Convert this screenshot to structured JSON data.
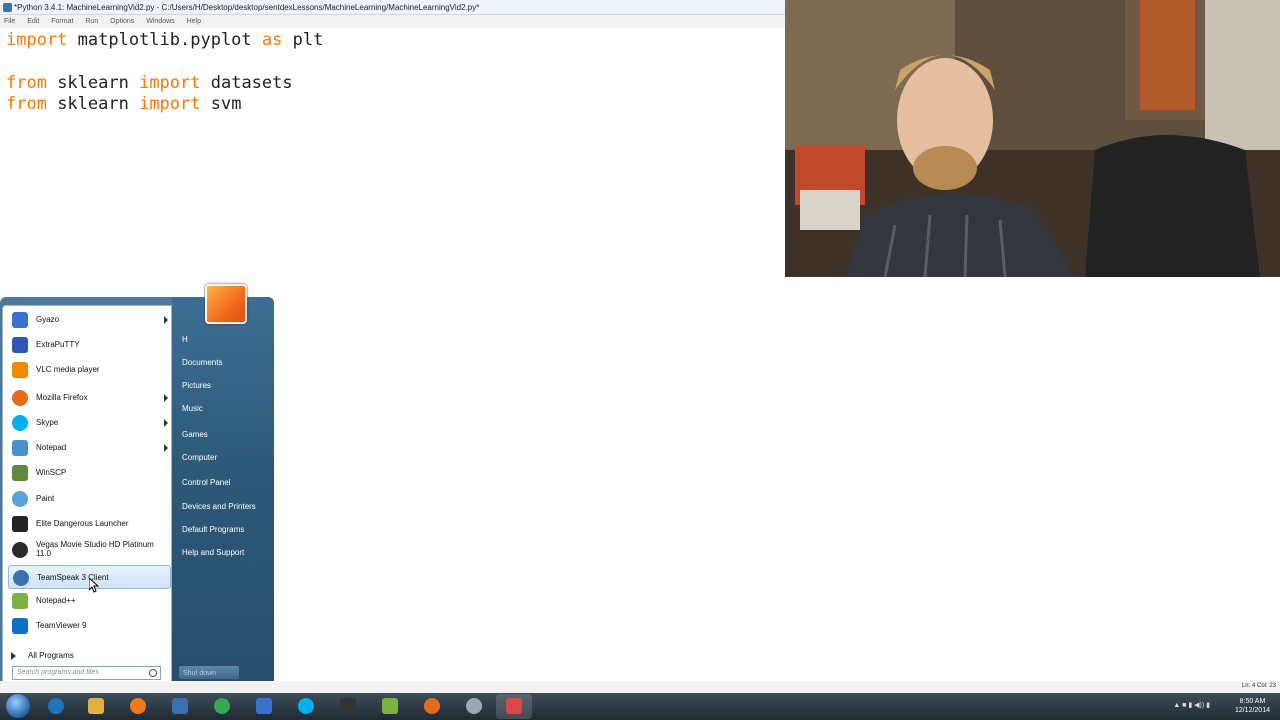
{
  "window": {
    "title": "*Python 3.4.1: MachineLearningVid2.py - C:/Users/H/Desktop/desktop/sentdexLessons/MachineLearning/MachineLearningVid2.py*"
  },
  "menubar": [
    "File",
    "Edit",
    "Format",
    "Run",
    "Options",
    "Windows",
    "Help"
  ],
  "code": [
    {
      "kw": "import",
      "rest1": " matplotlib.pyplot ",
      "kw2": "as",
      "rest2": " plt"
    },
    {
      "kw": "from",
      "rest1": " sklearn ",
      "kw2": "import",
      "rest2": " datasets"
    },
    {
      "kw": "from",
      "rest1": " sklearn ",
      "kw2": "import",
      "rest2": " svm"
    }
  ],
  "start_menu": {
    "programs": [
      {
        "label": "Gyazo",
        "icon": "gyazo-icon",
        "color": "#3b6fd0",
        "has_arrow": true
      },
      {
        "label": "ExtraPuTTY",
        "icon": "putty-icon",
        "color": "#2d55b5",
        "has_arrow": false
      },
      {
        "label": "VLC media player",
        "icon": "vlc-icon",
        "color": "#f08a00",
        "has_arrow": false
      },
      {
        "label": "Mozilla Firefox",
        "icon": "firefox-icon",
        "color": "#e36b1c",
        "has_arrow": true
      },
      {
        "label": "Skype",
        "icon": "skype-icon",
        "color": "#00aff0",
        "has_arrow": true
      },
      {
        "label": "Notepad",
        "icon": "notepad-icon",
        "color": "#4b8fcf",
        "has_arrow": true
      },
      {
        "label": "WinSCP",
        "icon": "winscp-icon",
        "color": "#5d8a3c",
        "has_arrow": false
      },
      {
        "label": "Paint",
        "icon": "paint-icon",
        "color": "#5aa1d8",
        "has_arrow": false
      },
      {
        "label": "Elite Dangerous Launcher",
        "icon": "elite-icon",
        "color": "#222222",
        "has_arrow": false
      },
      {
        "label": "Vegas Movie Studio HD Platinum 11.0",
        "icon": "vegas-icon",
        "color": "#2a2a2a",
        "has_arrow": false
      },
      {
        "label": "TeamSpeak 3 Client",
        "icon": "teamspeak-icon",
        "color": "#3a6fb0",
        "has_arrow": false
      },
      {
        "label": "Notepad++",
        "icon": "notepadpp-icon",
        "color": "#7bb342",
        "has_arrow": false
      },
      {
        "label": "TeamViewer 9",
        "icon": "teamviewer-icon",
        "color": "#0e6fc7",
        "has_arrow": false
      }
    ],
    "highlighted": "TeamSpeak 3 Client",
    "all_programs": "All Programs",
    "search_placeholder": "Search programs and files",
    "right_links": [
      "H",
      "Documents",
      "Pictures",
      "Music",
      "Games",
      "Computer",
      "Control Panel",
      "Devices and Printers",
      "Default Programs",
      "Help and Support"
    ],
    "shutdown": "Shut down"
  },
  "statusbar": {
    "position": "Ln: 4 Col: 23"
  },
  "taskbar": {
    "apps": [
      {
        "icon": "ie-icon",
        "color": "#1e73be"
      },
      {
        "icon": "explorer-icon",
        "color": "#e0b040"
      },
      {
        "icon": "media-player-icon",
        "color": "#f07a1a"
      },
      {
        "icon": "python-icon",
        "color": "#3a6fb0"
      },
      {
        "icon": "chrome-icon",
        "color": "#34a853"
      },
      {
        "icon": "gyazo-icon",
        "color": "#3b6fd0"
      },
      {
        "icon": "folder-icon",
        "color": "#5aa1d8"
      },
      {
        "icon": "skype-icon",
        "color": "#00aff0"
      },
      {
        "icon": "elite-icon",
        "color": "#333333"
      },
      {
        "icon": "notepadpp-icon",
        "color": "#7bb342"
      },
      {
        "icon": "firefox-icon",
        "color": "#e36b1c"
      },
      {
        "icon": "search-icon",
        "color": "#9aa7b4"
      },
      {
        "icon": "paint-icon",
        "color": "#d84a4a"
      }
    ],
    "clock_time": "8:50 AM",
    "clock_date": "12/12/2014"
  }
}
